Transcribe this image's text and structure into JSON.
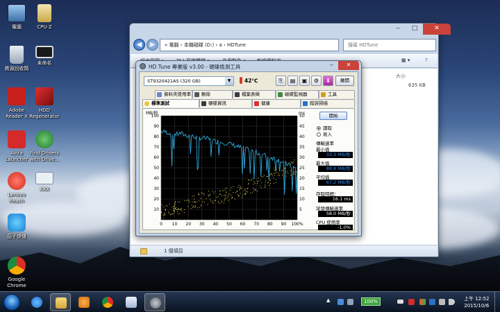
{
  "desktop": {
    "icons": [
      {
        "label": "電腦"
      },
      {
        "label": "CPU-Z"
      },
      {
        "label": "資源回收筒"
      },
      {
        "label": "未命名"
      },
      {
        "label": "Adobe Reader X"
      },
      {
        "label": "HDD Regenerator"
      },
      {
        "label": "Avira Launcher"
      },
      {
        "label": "Find Drivers with Drive..."
      },
      {
        "label": "Lenovo Reach"
      },
      {
        "label": "XXX"
      },
      {
        "label": "茄子快傳"
      },
      {
        "label": "Google Chrome"
      }
    ]
  },
  "explorer": {
    "address": "« 電腦 › 本機磁碟 (D:) › a › HDTune",
    "search_placeholder": "搜尋 HDTune",
    "commands": [
      "組合管理 ▾",
      "加入至媒體櫃 ▾",
      "共用對象 ▾",
      "新增資料夾"
    ],
    "column_size": "大小",
    "file_size": "635 KB",
    "status": "1 個項目"
  },
  "hdtune": {
    "title": "HD Tune 專業版 v3.00 - 硬碟檢測工具",
    "drive": "ST9320421AS  (320 GB)",
    "temperature": "42℃",
    "exit_label": "離開",
    "tabs_row1": [
      "資料夾使用率",
      "刪除",
      "檔案表徵",
      "磁碟監視器",
      "工具"
    ],
    "tabs_row2": [
      "標準測試",
      "硬碟資訊",
      "健康",
      "錯誤掃描"
    ],
    "start_label": "開始",
    "read_label": "讀取",
    "write_label": "寫入",
    "transfer_rate_label": "傳輸速率",
    "min_label": "最小值",
    "min_value": "33.3 MB/秒",
    "max_label": "最大值",
    "max_value": "88.8 MB/秒",
    "avg_label": "平均值",
    "avg_value": "67.2 MB/秒",
    "access_label": "存取時間：",
    "access_value": "16.1 ms",
    "burst_label": "突發傳輸速率",
    "burst_value": "58.0 MB/秒",
    "cpu_label": "CPU 使用率",
    "cpu_value": "-1.0%"
  },
  "chart_data": {
    "type": "line",
    "ylabel": "MB/秒",
    "y2label": "ms",
    "ylim": [
      0,
      100
    ],
    "y2lim": [
      0,
      50
    ],
    "y_ticks": [
      "100",
      "90",
      "80",
      "70",
      "60",
      "50",
      "40",
      "30",
      "20",
      "10"
    ],
    "y2_ticks": [
      "50",
      "45",
      "40",
      "35",
      "30",
      "25",
      "20",
      "15",
      "10",
      "5"
    ],
    "x_ticks": [
      "0",
      "10",
      "20",
      "30",
      "40",
      "50",
      "60",
      "70",
      "80",
      "90",
      "100%"
    ],
    "series": [
      {
        "values": [
          85,
          84,
          82,
          83,
          81,
          80,
          79,
          78,
          76,
          75,
          74,
          72,
          70,
          68,
          66,
          64,
          62,
          60,
          58,
          55,
          52,
          48
        ]
      },
      {
        "values": [
          4,
          5,
          6,
          7,
          8,
          9,
          10,
          11,
          11,
          12,
          13,
          14,
          16,
          17,
          18,
          20,
          21,
          23,
          25,
          26
        ]
      }
    ],
    "colors": {
      "transfer": "#2fa8d8",
      "access": "#e8e05a",
      "grid": "#3a3a3a",
      "background": "#000000"
    }
  },
  "taskbar": {
    "battery": "100%",
    "time": "上午 12:52",
    "date": "2015/10/6"
  }
}
